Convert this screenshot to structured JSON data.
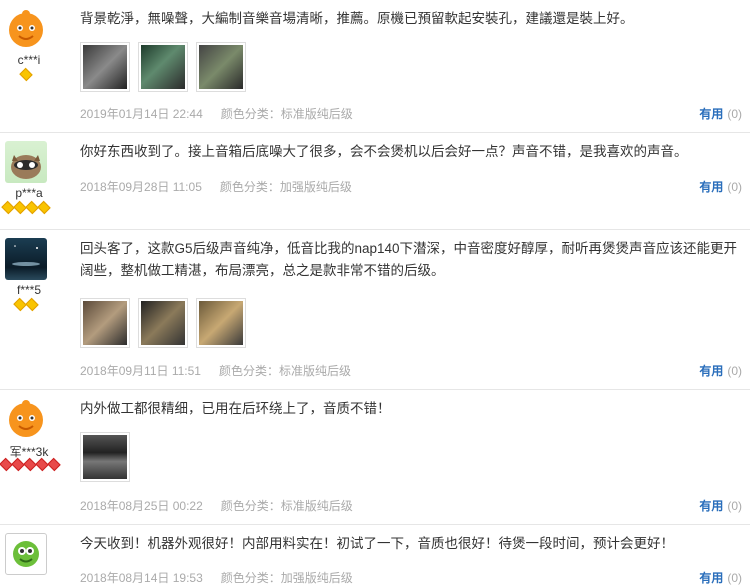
{
  "reviews": [
    {
      "nick": "c***i",
      "rank_count": 1,
      "text": "背景乾淨，無噪聲，大編制音樂音場清晰，推薦。原機已預留軟起安裝孔，建議還是裝上好。",
      "date": "2019年01月14日 22:44",
      "spec": "颜色分类：标准版纯后级",
      "useful_label": "有用",
      "useful_count": "(0)"
    },
    {
      "nick": "p***a",
      "rank_count": 4,
      "text": "你好东西收到了。接上音箱后底噪大了很多，会不会煲机以后会好一点？声音不错，是我喜欢的声音。",
      "date": "2018年09月28日 11:05",
      "spec": "颜色分类：加强版纯后级",
      "useful_label": "有用",
      "useful_count": "(0)"
    },
    {
      "nick": "f***5",
      "rank_count": 2,
      "text": "回头客了，这款G5后级声音纯净，低音比我的nap140下潜深，中音密度好醇厚，耐听再煲煲声音应该还能更开阔些，整机做工精湛，布局漂亮，总之是款非常不错的后级。",
      "date": "2018年09月11日 11:51",
      "spec": "颜色分类：标准版纯后级",
      "useful_label": "有用",
      "useful_count": "(0)"
    },
    {
      "nick": "军***3k",
      "rank_count": 5,
      "text": "内外做工都很精细，已用在后环绕上了，音质不错！",
      "date": "2018年08月25日 00:22",
      "spec": "颜色分类：标准版纯后级",
      "useful_label": "有用",
      "useful_count": "(0)"
    },
    {
      "nick": "",
      "rank_count": 0,
      "text": "今天收到！机器外观很好！内部用料实在！初试了一下，音质也很好！待煲一段时间，预计会更好！",
      "date": "2018年08月14日 19:53",
      "spec": "颜色分类：加强版纯后级",
      "useful_label": "有用",
      "useful_count": "(0)"
    }
  ]
}
